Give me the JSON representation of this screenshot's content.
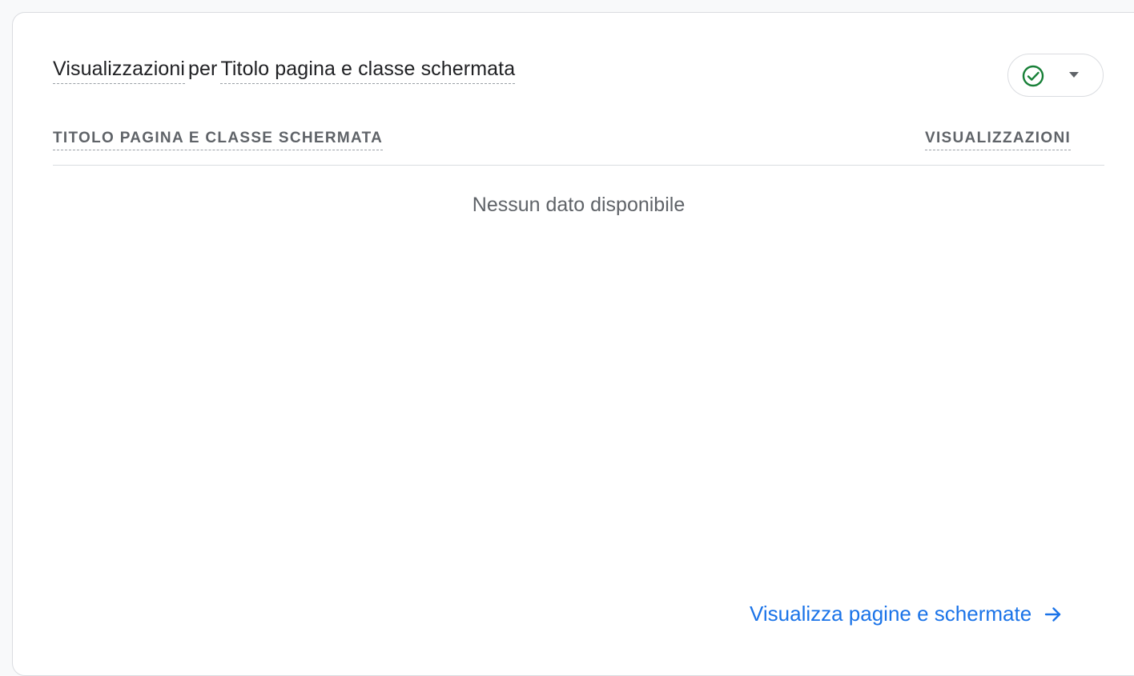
{
  "card": {
    "title_metric": "Visualizzazioni",
    "title_connector": "per",
    "title_dimension": "Titolo pagina e classe schermata",
    "status_icon": "check-circle-icon",
    "status_color": "#188038",
    "dropdown_icon": "caret-down-icon"
  },
  "table": {
    "columns": [
      "TITOLO PAGINA E CLASSE SCHERMATA",
      "VISUALIZZAZIONI"
    ],
    "rows": [],
    "empty_message": "Nessun dato disponibile"
  },
  "footer": {
    "link_label": "Visualizza pagine e schermate",
    "link_icon": "arrow-right-icon",
    "link_color": "#1a73e8"
  }
}
